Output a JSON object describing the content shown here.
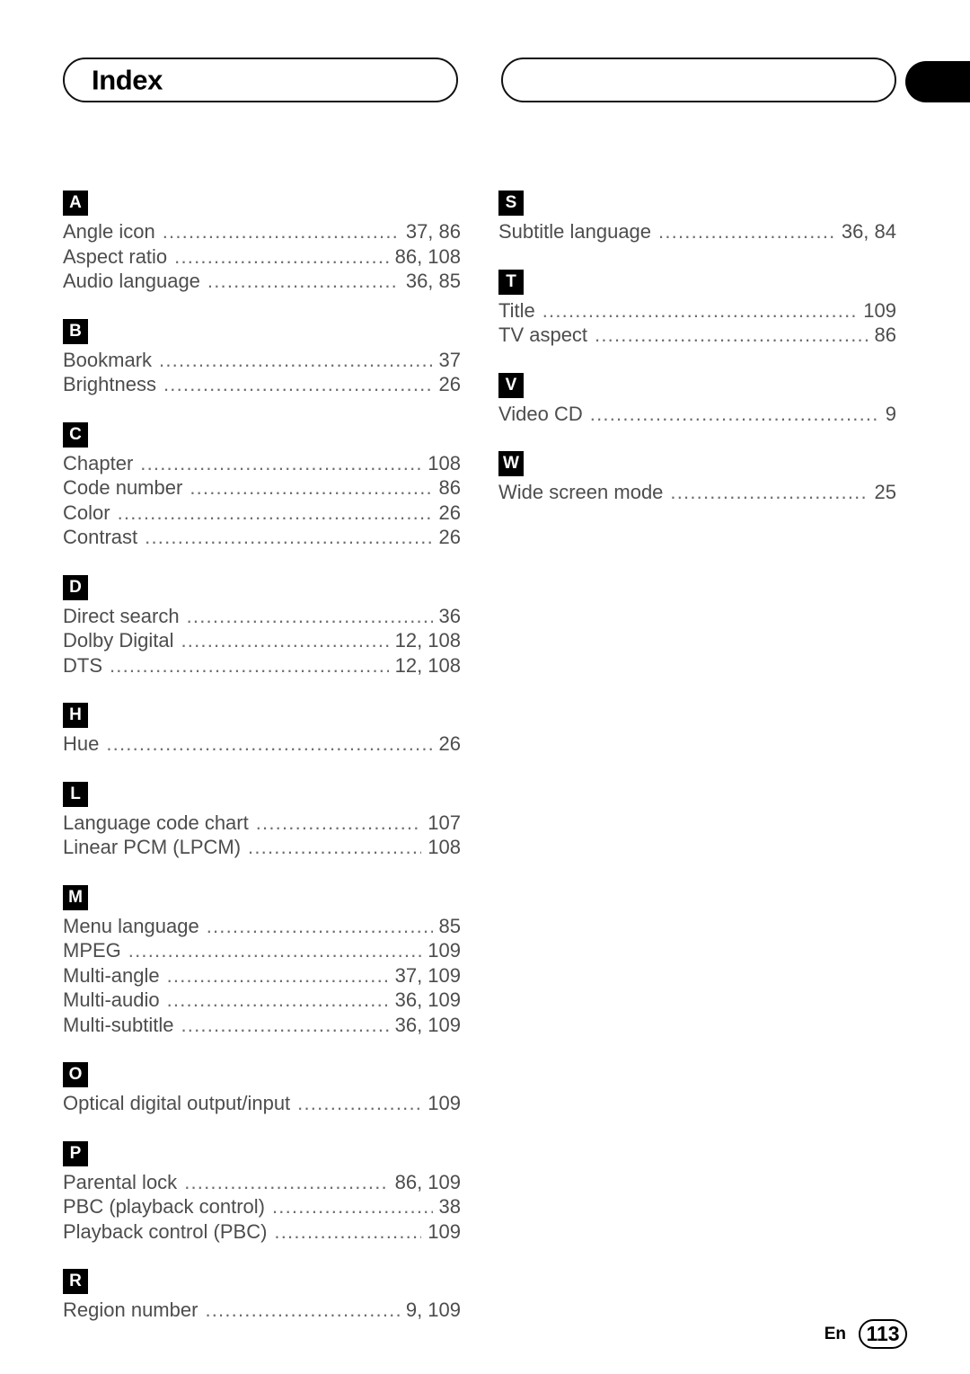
{
  "header": {
    "title": "Index"
  },
  "footer": {
    "language": "En",
    "page_number": "113"
  },
  "columns": [
    {
      "sections": [
        {
          "letter": "A",
          "entries": [
            {
              "label": "Angle icon",
              "pages": "37, 86"
            },
            {
              "label": "Aspect ratio",
              "pages": "86, 108"
            },
            {
              "label": "Audio language",
              "pages": "36, 85"
            }
          ]
        },
        {
          "letter": "B",
          "entries": [
            {
              "label": "Bookmark",
              "pages": "37"
            },
            {
              "label": "Brightness",
              "pages": "26"
            }
          ]
        },
        {
          "letter": "C",
          "entries": [
            {
              "label": "Chapter",
              "pages": "108"
            },
            {
              "label": "Code number",
              "pages": "86"
            },
            {
              "label": "Color",
              "pages": "26"
            },
            {
              "label": "Contrast",
              "pages": "26"
            }
          ]
        },
        {
          "letter": "D",
          "entries": [
            {
              "label": "Direct search",
              "pages": "36"
            },
            {
              "label": "Dolby Digital",
              "pages": "12, 108"
            },
            {
              "label": "DTS",
              "pages": "12, 108"
            }
          ]
        },
        {
          "letter": "H",
          "entries": [
            {
              "label": "Hue",
              "pages": "26"
            }
          ]
        },
        {
          "letter": "L",
          "entries": [
            {
              "label": "Language code chart",
              "pages": "107"
            },
            {
              "label": "Linear PCM (LPCM)",
              "pages": "108"
            }
          ]
        },
        {
          "letter": "M",
          "entries": [
            {
              "label": "Menu language",
              "pages": "85"
            },
            {
              "label": "MPEG",
              "pages": "109"
            },
            {
              "label": "Multi-angle",
              "pages": "37, 109"
            },
            {
              "label": "Multi-audio",
              "pages": "36, 109"
            },
            {
              "label": "Multi-subtitle",
              "pages": "36, 109"
            }
          ]
        },
        {
          "letter": "O",
          "entries": [
            {
              "label": "Optical digital output/input",
              "pages": "109"
            }
          ]
        },
        {
          "letter": "P",
          "entries": [
            {
              "label": "Parental lock",
              "pages": "86, 109"
            },
            {
              "label": "PBC (playback control)",
              "pages": "38"
            },
            {
              "label": "Playback control (PBC)",
              "pages": "109"
            }
          ]
        },
        {
          "letter": "R",
          "entries": [
            {
              "label": "Region number",
              "pages": "9, 109"
            }
          ]
        }
      ]
    },
    {
      "sections": [
        {
          "letter": "S",
          "entries": [
            {
              "label": "Subtitle language",
              "pages": "36, 84"
            }
          ]
        },
        {
          "letter": "T",
          "entries": [
            {
              "label": "Title",
              "pages": "109"
            },
            {
              "label": "TV aspect",
              "pages": "86"
            }
          ]
        },
        {
          "letter": "V",
          "entries": [
            {
              "label": "Video CD",
              "pages": "9"
            }
          ]
        },
        {
          "letter": "W",
          "entries": [
            {
              "label": "Wide screen mode",
              "pages": "25"
            }
          ]
        }
      ]
    }
  ]
}
